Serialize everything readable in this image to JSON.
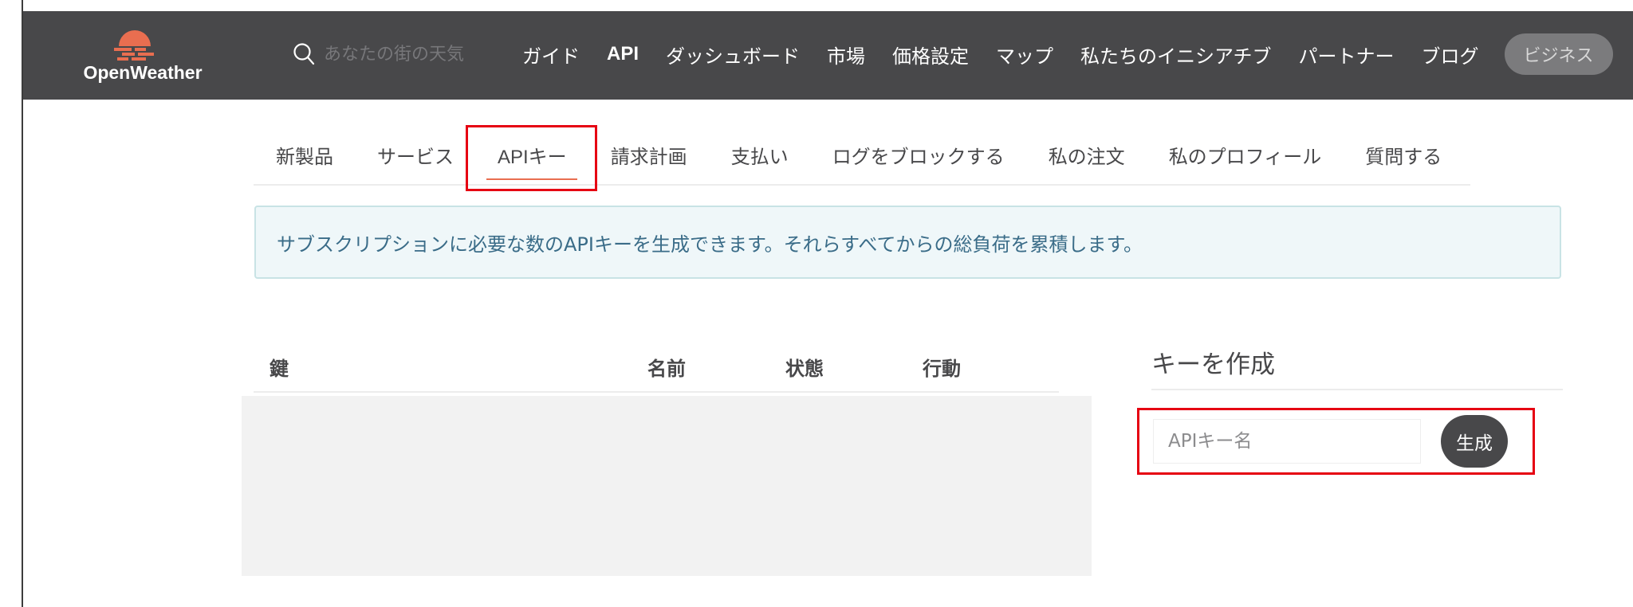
{
  "header": {
    "logo_text": "OpenWeather",
    "search_placeholder": "あなたの街の天気",
    "nav": {
      "guide": "ガイド",
      "api": "API",
      "dashboard": "ダッシュボード",
      "market": "市場",
      "pricing": "価格設定",
      "map": "マップ",
      "initiatives": "私たちのイニシアチブ",
      "partners": "パートナー",
      "blog": "ブログ",
      "business": "ビジネス"
    }
  },
  "tabs": {
    "new_products": "新製品",
    "services": "サービス",
    "api_keys": "APIキー",
    "billing_plans": "請求計画",
    "payments": "支払い",
    "block_logs": "ログをブロックする",
    "my_orders": "私の注文",
    "my_profile": "私のプロフィール",
    "ask_question": "質問する"
  },
  "alert": {
    "text": "サブスクリプションに必要な数のAPIキーを生成できます。それらすべてからの総負荷を累積します。"
  },
  "table": {
    "col_key": "鍵",
    "col_name": "名前",
    "col_status": "状態",
    "col_action": "行動"
  },
  "create": {
    "title": "キーを作成",
    "input_placeholder": "APIキー名",
    "button_label": "生成"
  },
  "colors": {
    "header_bg": "#48484a",
    "brand_orange": "#e96e50",
    "highlight_red": "#e60012",
    "alert_bg": "#eff7f9",
    "alert_text": "#3a6c88"
  }
}
